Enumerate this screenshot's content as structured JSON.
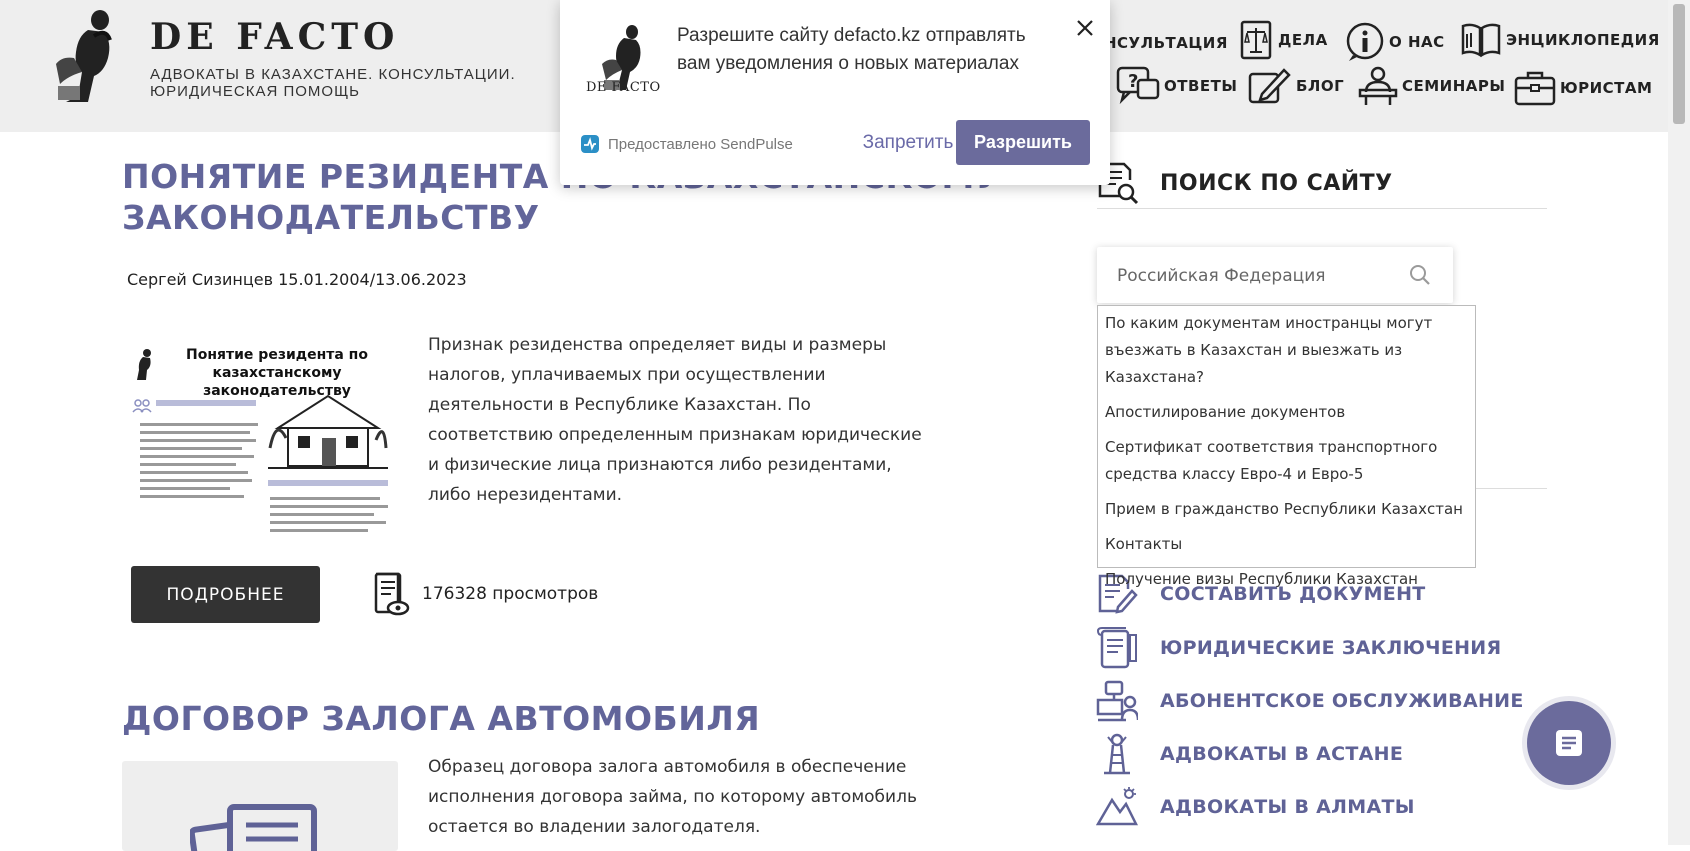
{
  "header": {
    "brand": "DE FACTO",
    "subtitle": "АДВОКАТЫ В КАЗАХСТАНЕ. КОНСУЛЬТАЦИИ. ЮРИДИЧЕСКАЯ ПОМОЩЬ",
    "nav": [
      {
        "label": "НСУЛЬТАЦИЯ",
        "icon": "consultation-icon"
      },
      {
        "label": "ДЕЛА",
        "icon": "scales-icon"
      },
      {
        "label": "О НАС",
        "icon": "info-icon"
      },
      {
        "label": "ЭНЦИКЛОПЕДИЯ",
        "icon": "book-icon"
      },
      {
        "label": "ОТВЕТЫ",
        "icon": "question-icon"
      },
      {
        "label": "БЛОГ",
        "icon": "pen-icon"
      },
      {
        "label": "СЕМИНАРЫ",
        "icon": "lecturer-icon"
      },
      {
        "label": "ЮРИСТАМ",
        "icon": "briefcase-icon"
      }
    ]
  },
  "notification": {
    "logo_text": "DE FACTO",
    "message": "Разрешите сайту defacto.kz отправлять вам уведомления о новых материалах",
    "powered_by": "Предоставлено SendPulse",
    "deny_label": "Запретить",
    "allow_label": "Разрешить"
  },
  "articles": [
    {
      "title": "ПОНЯТИЕ РЕЗИДЕНТА ПО КАЗАХСТАНСКОМУ ЗАКОНОДАТЕЛЬСТВУ",
      "meta": "Сергей Сизинцев 15.01.2004/13.06.2023",
      "thumb_title": "Понятие резидента по казахстанскому законодательству",
      "excerpt": "Признак резиденства определяет виды и размеры налогов, уплачиваемых при осуществлении деятельности в Республике Казахстан. По соответствию определенным признакам юридические и физические лица признаются либо резидентами, либо нерезидентами.",
      "more_label": "ПОДРОБНЕЕ",
      "views": "176328 просмотров"
    },
    {
      "title": "ДОГОВОР ЗАЛОГА АВТОМОБИЛЯ",
      "excerpt": "Образец договора залога автомобиля в обеспечение исполнения договора займа, по которому автомобиль остается во владении залогодателя."
    }
  ],
  "sidebar": {
    "search_heading": "ПОИСК ПО САЙТУ",
    "search_value": "Российская Федерация",
    "suggestions": [
      "По каким документам иностранцы могут въезжать в Казахстан и выезжать из Казахстана?",
      "Апостилирование документов",
      "Сертификат соответствия транспортного средства классу Евро-4 и Евро-5",
      "Прием в гражданство Республики Казахстан",
      "Контакты",
      "Получение визы Республики Казахстан"
    ],
    "links": [
      {
        "label": "СОСТАВИТЬ ДОКУМЕНТ",
        "icon": "document-edit-icon"
      },
      {
        "label": "ЮРИДИЧЕСКИЕ ЗАКЛЮЧЕНИЯ",
        "icon": "scroll-icon"
      },
      {
        "label": "АБОНЕНТСКОЕ ОБСЛУЖИВАНИЕ",
        "icon": "support-desk-icon"
      },
      {
        "label": "АДВОКАТЫ В АСТАНЕ",
        "icon": "astana-tower-icon"
      },
      {
        "label": "АДВОКАТЫ В АЛМАТЫ",
        "icon": "mountains-icon"
      }
    ]
  },
  "colors": {
    "accent": "#62659a",
    "button_dark": "#333333",
    "allow_button": "#6b6b9c",
    "header_bg": "#eeeeee"
  }
}
